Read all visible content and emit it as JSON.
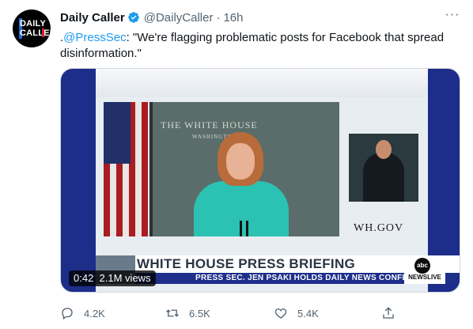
{
  "tweet": {
    "display_name": "Daily Caller",
    "handle": "@DailyCaller",
    "separator": "·",
    "time": "16h",
    "more_label": "···",
    "avatar_line1": "DAILY",
    "avatar_line2": "CALLER",
    "text_prefix": ".",
    "mention": "@PressSec",
    "text_body": ": \"We're flagging problematic posts for Facebook that spread disinformation.\"",
    "colors": {
      "link": "#1d9bf0",
      "verified": "#1d9bf0",
      "muted": "#536471"
    }
  },
  "media": {
    "duration": "0:42",
    "views": "2.1M views",
    "backdrop_text": "THE WHITE HOUSE",
    "backdrop_subtext": "WASHINGTON",
    "site_text": "WH.GOV",
    "headline": "WHITE HOUSE PRESS BRIEFING",
    "subline": "PRESS SEC. JEN PSAKI HOLDS DAILY NEWS CONFERENCE",
    "network_logo": "abc",
    "network_label": "NEWSLIVE"
  },
  "actions": {
    "reply_count": "4.2K",
    "retweet_count": "6.5K",
    "like_count": "5.4K",
    "icons": [
      "reply-icon",
      "retweet-icon",
      "like-icon",
      "share-icon"
    ]
  }
}
